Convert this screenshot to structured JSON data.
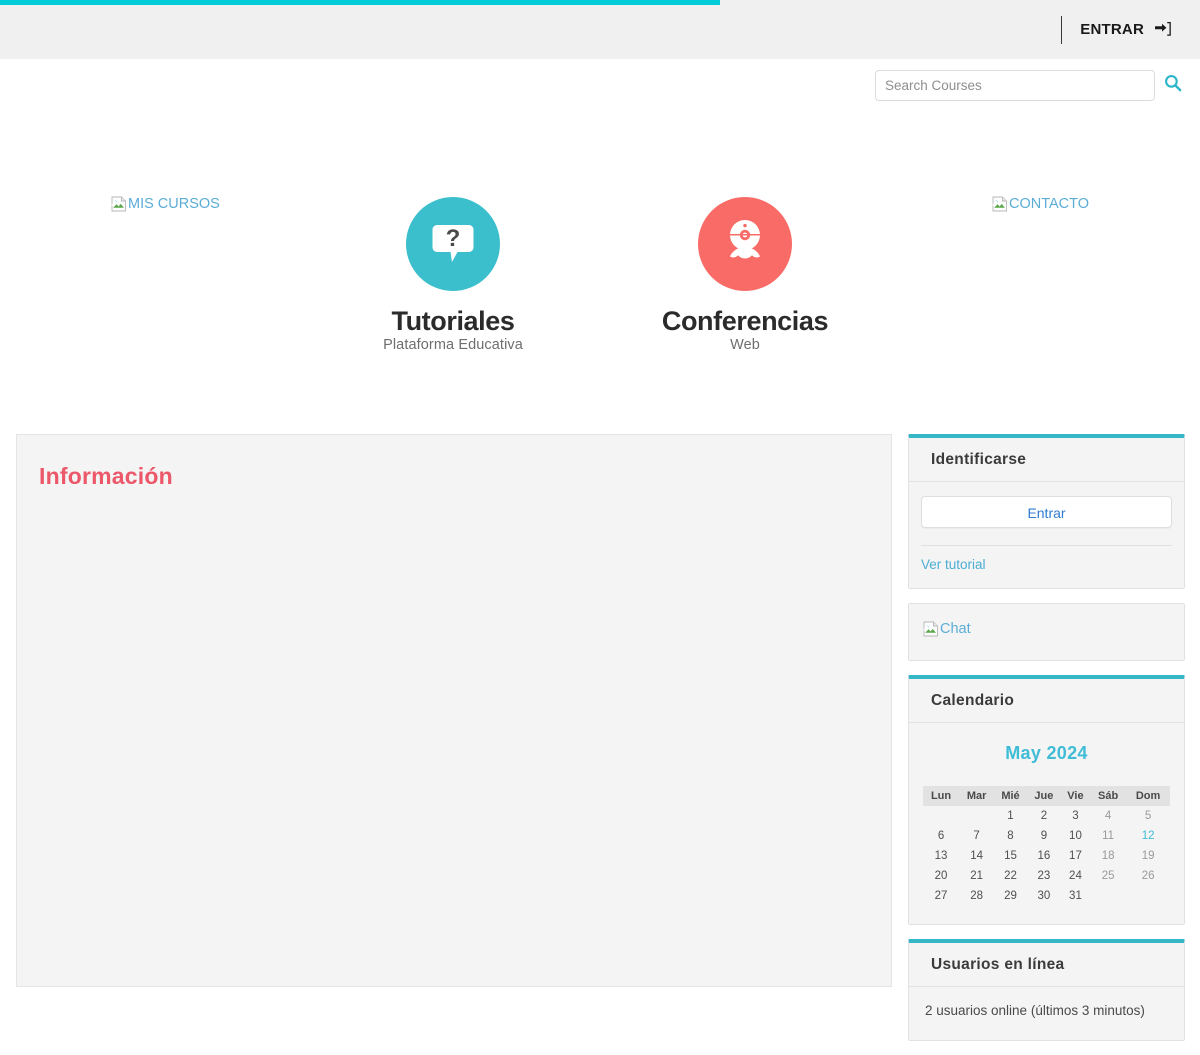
{
  "progress": {
    "percent": 60
  },
  "navbar": {
    "login_label": "ENTRAR",
    "login_icon": "sign-in-icon"
  },
  "search": {
    "placeholder": "Search Courses",
    "value": "",
    "icon": "search-icon"
  },
  "brand": {
    "links": [
      {
        "alt": "MIS CURSOS",
        "icon": "broken-image-icon"
      },
      {
        "alt": "CONTACTO",
        "icon": "broken-image-icon"
      }
    ],
    "logos": [
      {
        "title": "Tutoriales",
        "subtitle": "Plataforma Educativa",
        "icon": "question-speech-bubble-icon",
        "color": "#3cbfcd"
      },
      {
        "title": "Conferencias",
        "subtitle": "Web",
        "icon": "webcam-icon",
        "color": "#f96b66"
      }
    ]
  },
  "main": {
    "heading": "Información"
  },
  "sidebar": {
    "login_block": {
      "title": "Identificarse",
      "button_label": "Entrar",
      "tutorial_link": "Ver tutorial"
    },
    "chat_block": {
      "alt": "Chat",
      "icon": "broken-image-icon"
    },
    "calendar_block": {
      "title": "Calendario",
      "month_label": "May 2024",
      "day_headers": [
        "Lun",
        "Mar",
        "Mié",
        "Jue",
        "Vie",
        "Sáb",
        "Dom"
      ],
      "weeks": [
        [
          "",
          "",
          "1",
          "2",
          "3",
          "4",
          "5"
        ],
        [
          "6",
          "7",
          "8",
          "9",
          "10",
          "11",
          "12"
        ],
        [
          "13",
          "14",
          "15",
          "16",
          "17",
          "18",
          "19"
        ],
        [
          "20",
          "21",
          "22",
          "23",
          "24",
          "25",
          "26"
        ],
        [
          "27",
          "28",
          "29",
          "30",
          "31",
          "",
          ""
        ]
      ],
      "today": "12",
      "weekend_columns": [
        5,
        6
      ]
    },
    "online_block": {
      "title": "Usuarios en línea",
      "text": "2 usuarios online (últimos 3 minutos)"
    }
  },
  "colors": {
    "accent_teal": "#35b7c8",
    "progress_teal": "#00cdd7",
    "heading_pink": "#ec5769",
    "link_blue": "#4badd3",
    "broken_alt_blue": "#5badd6"
  }
}
